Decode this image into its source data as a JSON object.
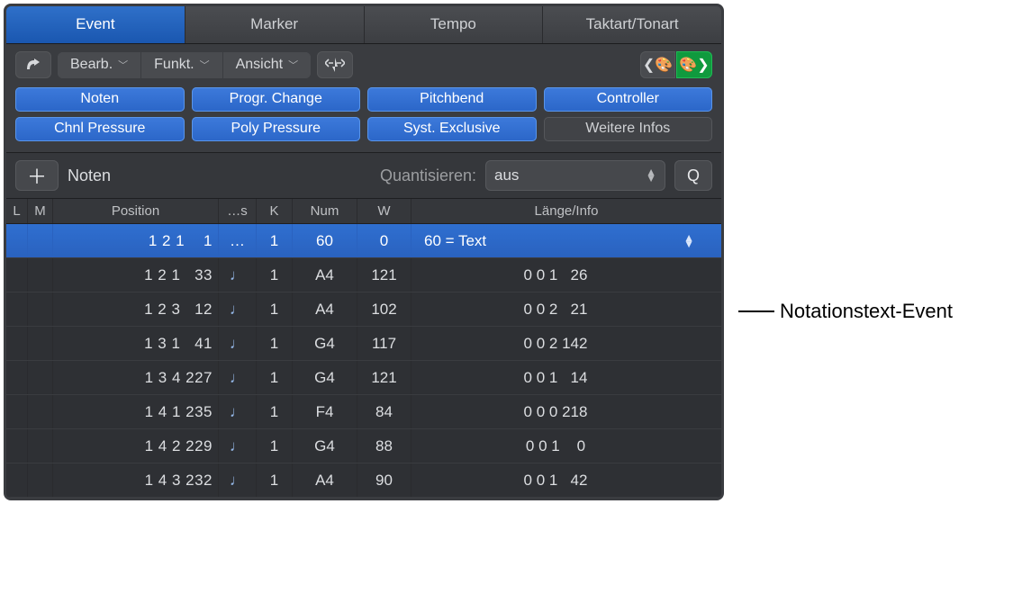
{
  "tabs": [
    "Event",
    "Marker",
    "Tempo",
    "Taktart/Tonart"
  ],
  "active_tab": 0,
  "toolbar": {
    "edit": "Bearb.",
    "func": "Funkt.",
    "view": "Ansicht"
  },
  "filters_row1": [
    "Noten",
    "Progr. Change",
    "Pitchbend",
    "Controller"
  ],
  "filters_row2": [
    "Chnl Pressure",
    "Poly Pressure",
    "Syst. Exclusive",
    "Weitere Infos"
  ],
  "filters_row2_off_index": 3,
  "action": {
    "type_label": "Noten",
    "quantize_label": "Quantisieren:",
    "quantize_value": "aus",
    "q_button": "Q"
  },
  "columns": {
    "l": "L",
    "m": "M",
    "pos": "Position",
    "s": "…s",
    "k": "K",
    "num": "Num",
    "w": "W",
    "info": "Länge/Info"
  },
  "rows": [
    {
      "pos": "1 2 1    1",
      "s": "…",
      "k": "1",
      "num": "60",
      "w": "0",
      "info": "60 = Text",
      "selected": true,
      "dropdown": true
    },
    {
      "pos": "1 2 1   33",
      "s": "note",
      "k": "1",
      "num": "A4",
      "w": "121",
      "info": "0 0 1   26"
    },
    {
      "pos": "1 2 3   12",
      "s": "note",
      "k": "1",
      "num": "A4",
      "w": "102",
      "info": "0 0 2   21"
    },
    {
      "pos": "1 3 1   41",
      "s": "note",
      "k": "1",
      "num": "G4",
      "w": "117",
      "info": "0 0 2 142"
    },
    {
      "pos": "1 3 4 227",
      "s": "note",
      "k": "1",
      "num": "G4",
      "w": "121",
      "info": "0 0 1   14"
    },
    {
      "pos": "1 4 1 235",
      "s": "note",
      "k": "1",
      "num": "F4",
      "w": "84",
      "info": "0 0 0 218"
    },
    {
      "pos": "1 4 2 229",
      "s": "note",
      "k": "1",
      "num": "G4",
      "w": "88",
      "info": "0 0 1    0"
    },
    {
      "pos": "1 4 3 232",
      "s": "note",
      "k": "1",
      "num": "A4",
      "w": "90",
      "info": "0 0 1   42"
    }
  ],
  "callout": "Notationstext-Event"
}
